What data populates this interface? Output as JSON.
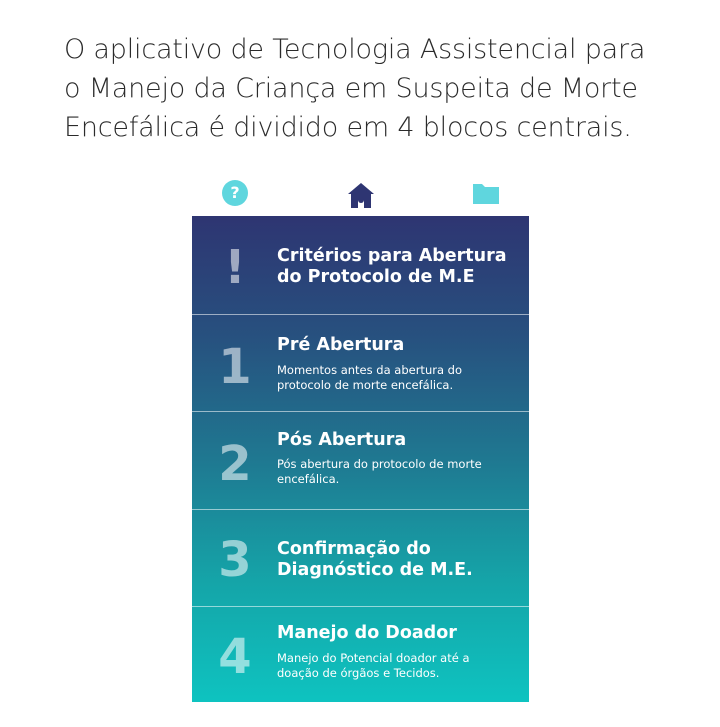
{
  "caption": {
    "line1": "O aplicativo de Tecnologia Assistencial para",
    "line2": "o Manejo da Criança em Suspeita de Morte",
    "line3": "Encefálica é dividido em 4 blocos centrais."
  },
  "nav": {
    "help": {
      "icon": "help-circle-icon",
      "glyph": "?"
    },
    "home": {
      "icon": "home-icon"
    },
    "folder": {
      "icon": "folder-icon"
    },
    "icon_color_light": "#5fd6de",
    "icon_color_dark": "#2e3572"
  },
  "menu": {
    "gradient_top": "#2e3572",
    "gradient_bottom": "#0ec3c0",
    "items": [
      {
        "marker": "!",
        "title_line1": "Critérios para Abertura",
        "title_line2": "do Protocolo de M.E"
      },
      {
        "marker": "1",
        "title_line1": "Pré Abertura",
        "desc_line1": "Momentos antes da abertura do",
        "desc_line2": "protocolo de morte encefálica."
      },
      {
        "marker": "2",
        "title_line1": "Pós Abertura",
        "desc_line1": "Pós abertura do protocolo de morte",
        "desc_line2": "encefálica."
      },
      {
        "marker": "3",
        "title_line1": "Confirmação do",
        "title_line2": "Diagnóstico de M.E."
      },
      {
        "marker": "4",
        "title_line1": "Manejo do Doador",
        "desc_line1": "Manejo do Potencial doador até a",
        "desc_line2": "doação de órgãos e Tecidos."
      }
    ]
  }
}
